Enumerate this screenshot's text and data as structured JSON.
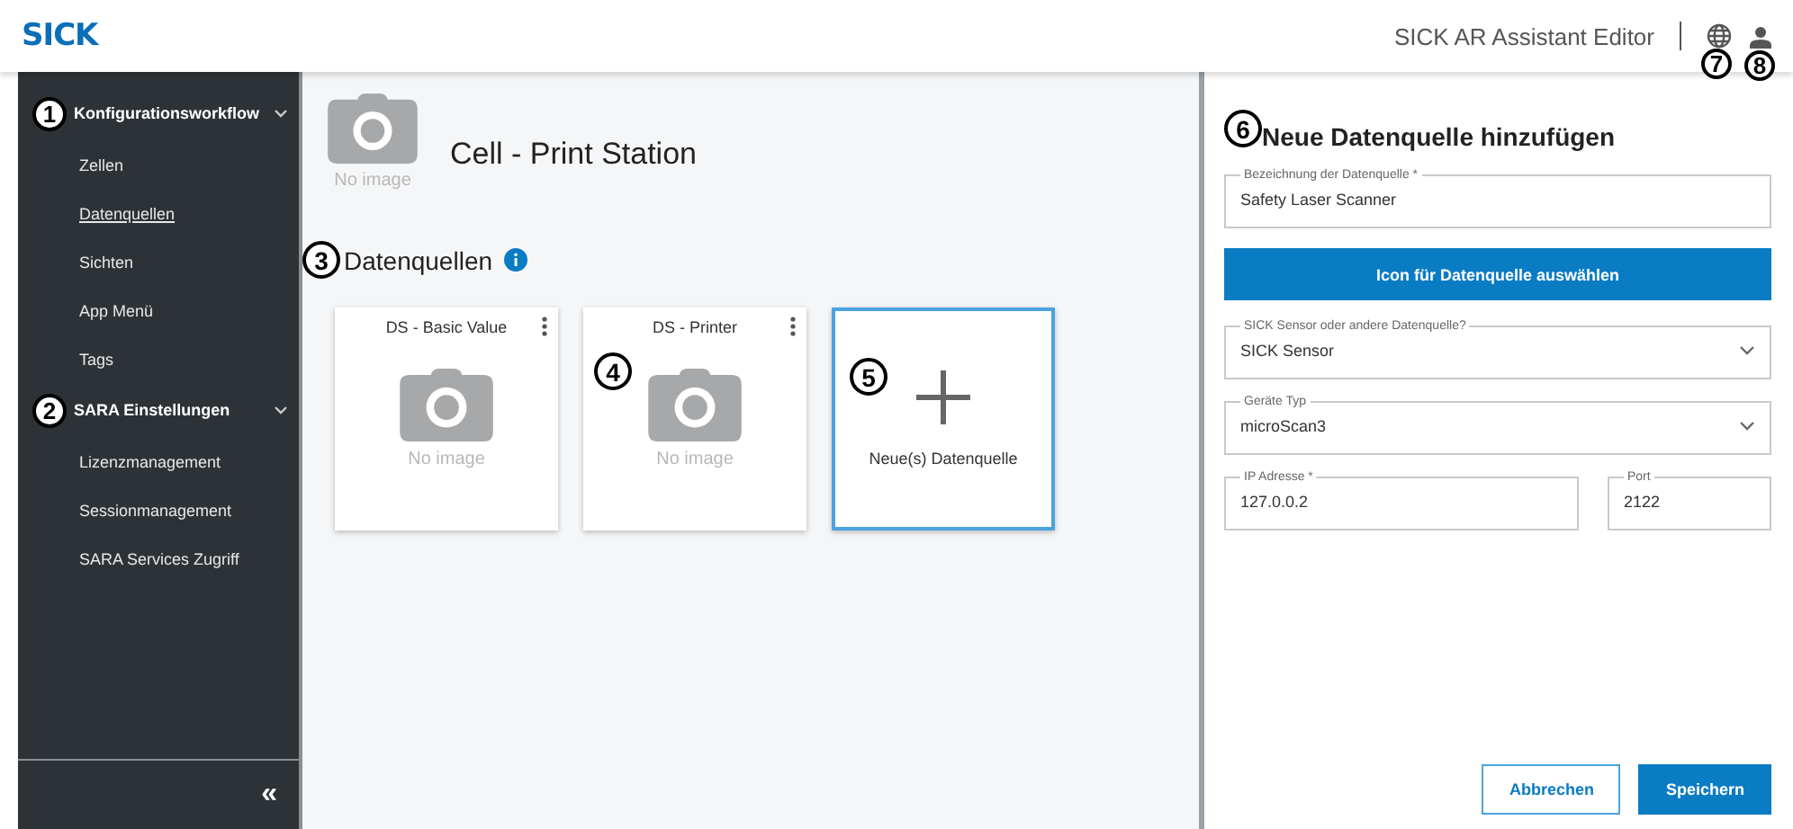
{
  "header": {
    "logo": "SICK",
    "app_title": "SICK AR Assistant Editor",
    "icon_callouts": [
      "7",
      "8"
    ]
  },
  "sidebar": {
    "groups": [
      {
        "marker": "1",
        "title": "Konfigurationsworkflow",
        "expanded": true,
        "items": [
          {
            "label": "Zellen",
            "selected": false
          },
          {
            "label": "Datenquellen",
            "selected": true
          },
          {
            "label": "Sichten",
            "selected": false
          },
          {
            "label": "App Menü",
            "selected": false
          },
          {
            "label": "Tags",
            "selected": false
          }
        ]
      },
      {
        "marker": "2",
        "title": "SARA Einstellungen",
        "expanded": true,
        "items": [
          {
            "label": "Lizenzmanagement",
            "selected": false
          },
          {
            "label": "Sessionmanagement",
            "selected": false
          },
          {
            "label": "SARA Services Zugriff",
            "selected": false
          }
        ]
      }
    ],
    "collapse": "«"
  },
  "cell": {
    "title": "Cell - Print Station",
    "image_caption": "No image"
  },
  "section": {
    "marker": "3",
    "title": "Datenquellen"
  },
  "cards": [
    {
      "kind": "source",
      "title": "DS - Basic Value",
      "image_caption": "No image"
    },
    {
      "kind": "source",
      "title": "DS - Printer",
      "image_caption": "No image",
      "marker": "4"
    },
    {
      "kind": "add",
      "label": "Neue(s) Datenquelle",
      "marker": "5"
    }
  ],
  "panel": {
    "marker": "6",
    "title": "Neue Datenquelle hinzufügen",
    "rows": [
      [
        {
          "kind": "text",
          "label": "Bezeichnung der Datenquelle *",
          "value": "Safety Laser Scanner"
        }
      ],
      [
        {
          "kind": "button",
          "label": "Icon für Datenquelle auswählen"
        }
      ],
      [
        {
          "kind": "select",
          "label": "SICK Sensor oder andere Datenquelle?",
          "value": "SICK Sensor"
        }
      ],
      [
        {
          "kind": "select",
          "label": "Geräte Typ",
          "value": "microScan3"
        }
      ],
      [
        {
          "kind": "text",
          "label": "IP Adresse *",
          "value": "127.0.0.2"
        },
        {
          "kind": "text",
          "label": "Port",
          "value": "2122"
        }
      ]
    ],
    "buttons": [
      {
        "kind": "secondary",
        "label": "Abbrechen"
      },
      {
        "kind": "primary",
        "label": "Speichern"
      }
    ]
  }
}
